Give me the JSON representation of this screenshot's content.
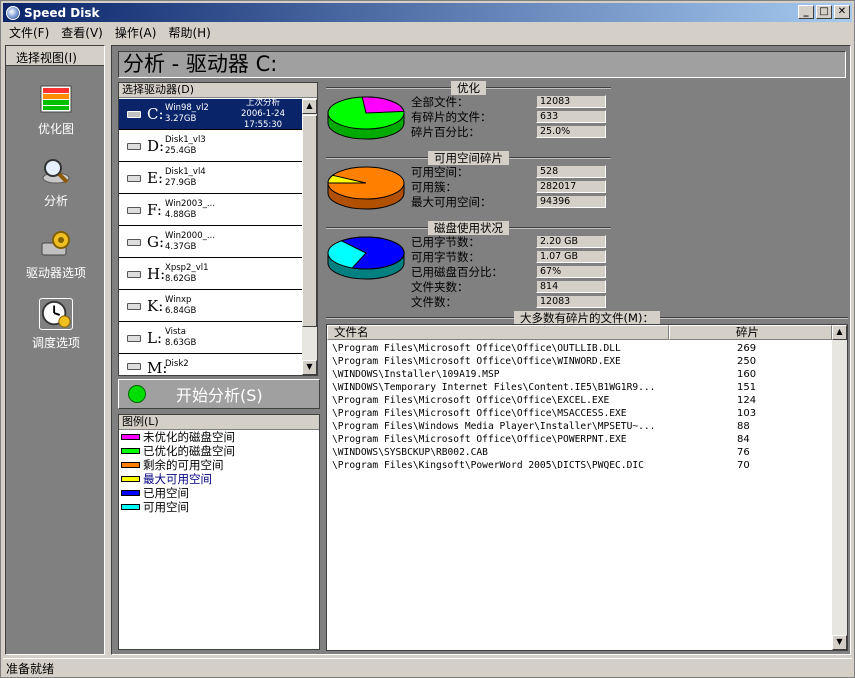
{
  "window": {
    "title": "Speed Disk",
    "min_label": "_",
    "max_label": "□",
    "close_label": "✕"
  },
  "menu": [
    "文件(F)",
    "查看(V)",
    "操作(A)",
    "帮助(H)"
  ],
  "left_panel": {
    "header": "选择视图(I)",
    "items": [
      {
        "label": "优化图",
        "icon": "optimize-map-icon"
      },
      {
        "label": "分析",
        "icon": "magnifier-disk-icon"
      },
      {
        "label": "驱动器选项",
        "icon": "drive-gear-icon"
      },
      {
        "label": "调度选项",
        "icon": "clock-schedule-icon"
      }
    ]
  },
  "header": {
    "title": "分析 - 驱动器 C:"
  },
  "drive_list": {
    "header": "选择驱动器(D)",
    "items": [
      {
        "letter": "C:",
        "name": "Win98_vl2",
        "size": "3.27GB",
        "status": "上次分析",
        "date": "2006-1-24 17:55:30"
      },
      {
        "letter": "D:",
        "name": "Disk1_vl3",
        "size": "25.4GB"
      },
      {
        "letter": "E:",
        "name": "Disk1_vl4",
        "size": "27.9GB"
      },
      {
        "letter": "F:",
        "name": "Win2003_...",
        "size": "4.88GB"
      },
      {
        "letter": "G:",
        "name": "Win2000_...",
        "size": "4.37GB"
      },
      {
        "letter": "H:",
        "name": "Xpsp2_vl1",
        "size": "8.62GB"
      },
      {
        "letter": "K:",
        "name": "Winxp",
        "size": "6.84GB"
      },
      {
        "letter": "L:",
        "name": "Vista",
        "size": "8.63GB"
      },
      {
        "letter": "M:",
        "name": "Disk2",
        "size": ""
      }
    ]
  },
  "start_button": {
    "label": "开始分析(S)"
  },
  "legend": {
    "header": "图例(L)",
    "items": [
      {
        "label": "未优化的磁盘空间",
        "color": "#ff00ff"
      },
      {
        "label": "已优化的磁盘空间",
        "color": "#00ff00"
      },
      {
        "label": "剩余的可用空间",
        "color": "#ff8000"
      },
      {
        "label": "最大可用空间",
        "color": "#ffff00"
      },
      {
        "label": "已用空间",
        "color": "#0000ff"
      },
      {
        "label": "可用空间",
        "color": "#00ffff"
      }
    ]
  },
  "optimize": {
    "title": "优化",
    "rows": [
      {
        "label": "全部文件：",
        "value": "12083"
      },
      {
        "label": "有碎片的文件：",
        "value": "633"
      },
      {
        "label": "碎片百分比：",
        "value": "25.0%"
      }
    ],
    "pie": {
      "fragmented_fraction": 0.25
    }
  },
  "free_space": {
    "title": "可用空间碎片",
    "rows": [
      {
        "label": "可用空间：",
        "value": "528"
      },
      {
        "label": "可用簇：",
        "value": "282017"
      },
      {
        "label": "最大可用空间：",
        "value": "94396"
      }
    ],
    "pie": {
      "largest_fraction": 0.08
    }
  },
  "disk_usage": {
    "title": "磁盘使用状况",
    "rows": [
      {
        "label": "已用字节数：",
        "value": "2.20 GB"
      },
      {
        "label": "可用字节数：",
        "value": "1.07 GB"
      },
      {
        "label": "已用磁盘百分比：",
        "value": "67%"
      },
      {
        "label": "文件夹数：",
        "value": "814"
      },
      {
        "label": "文件数：",
        "value": "12083"
      }
    ],
    "pie": {
      "used_fraction": 0.67
    }
  },
  "files": {
    "title": "大多数有碎片的文件(M)：",
    "col_name": "文件名",
    "col_frag": "碎片",
    "rows": [
      {
        "name": "\\Program Files\\Microsoft Office\\Office\\OUTLLIB.DLL",
        "frag": "269"
      },
      {
        "name": "\\Program Files\\Microsoft Office\\Office\\WINWORD.EXE",
        "frag": "250"
      },
      {
        "name": "\\WINDOWS\\Installer\\109A19.MSP",
        "frag": "160"
      },
      {
        "name": "\\WINDOWS\\Temporary Internet Files\\Content.IE5\\B1WG1R9...",
        "frag": "151"
      },
      {
        "name": "\\Program Files\\Microsoft Office\\Office\\EXCEL.EXE",
        "frag": "124"
      },
      {
        "name": "\\Program Files\\Microsoft Office\\Office\\MSACCESS.EXE",
        "frag": "103"
      },
      {
        "name": "\\Program Files\\Windows Media Player\\Installer\\MPSETU~...",
        "frag": "88"
      },
      {
        "name": "\\Program Files\\Microsoft Office\\Office\\POWERPNT.EXE",
        "frag": "84"
      },
      {
        "name": "\\WINDOWS\\SYSBCKUP\\RB002.CAB",
        "frag": "76"
      },
      {
        "name": "\\Program Files\\Kingsoft\\PowerWord 2005\\DICTS\\PWQEC.DIC",
        "frag": "70"
      }
    ]
  },
  "status": {
    "text": "准备就绪"
  }
}
